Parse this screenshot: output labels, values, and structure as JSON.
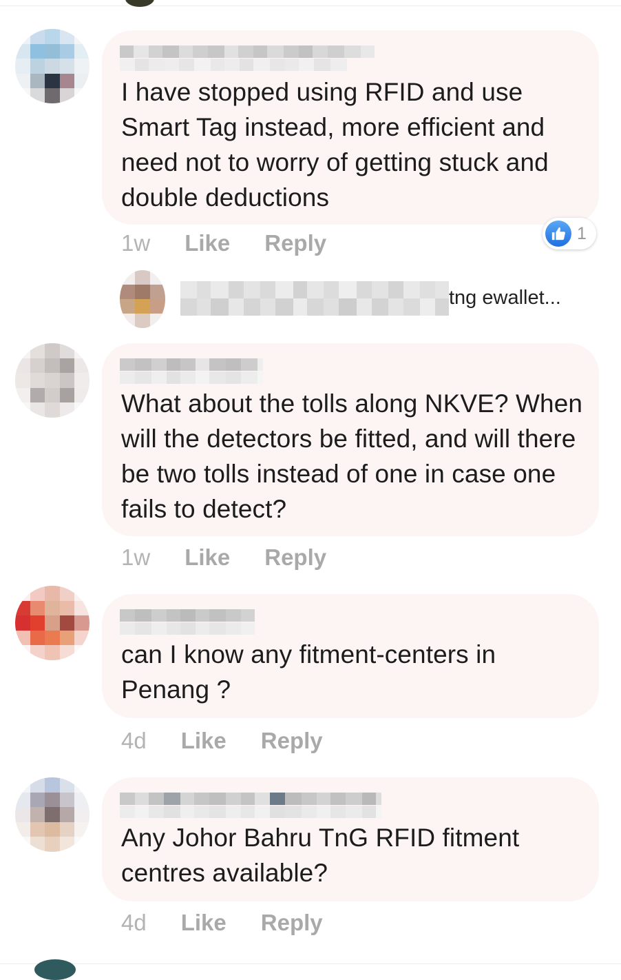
{
  "comments": [
    {
      "text": "I have stopped using RFID and use Smart Tag instead, more efficient and need not to worry of getting stuck and double deductions",
      "time": "1w",
      "like_label": "Like",
      "reply_label": "Reply",
      "reaction_count": "1"
    },
    {
      "text": "What about the tolls along NKVE? When will the detectors be fitted, and will there be two tolls instead of one in case one fails to detect?",
      "time": "1w",
      "like_label": "Like",
      "reply_label": "Reply"
    },
    {
      "text": "can I know any fitment-centers in Penang ?",
      "time": "4d",
      "like_label": "Like",
      "reply_label": "Reply"
    },
    {
      "text": "Any Johor Bahru TnG RFID fitment centres available?",
      "time": "4d",
      "like_label": "Like",
      "reply_label": "Reply"
    }
  ],
  "reply_preview": {
    "visible_text": "tng ewallet..."
  },
  "icons": {
    "reaction": "like-thumb-icon"
  },
  "colors": {
    "bubble": "#fdf5f4",
    "meta_text": "#a9a9a9",
    "like_blue": "#1f6fe0"
  }
}
